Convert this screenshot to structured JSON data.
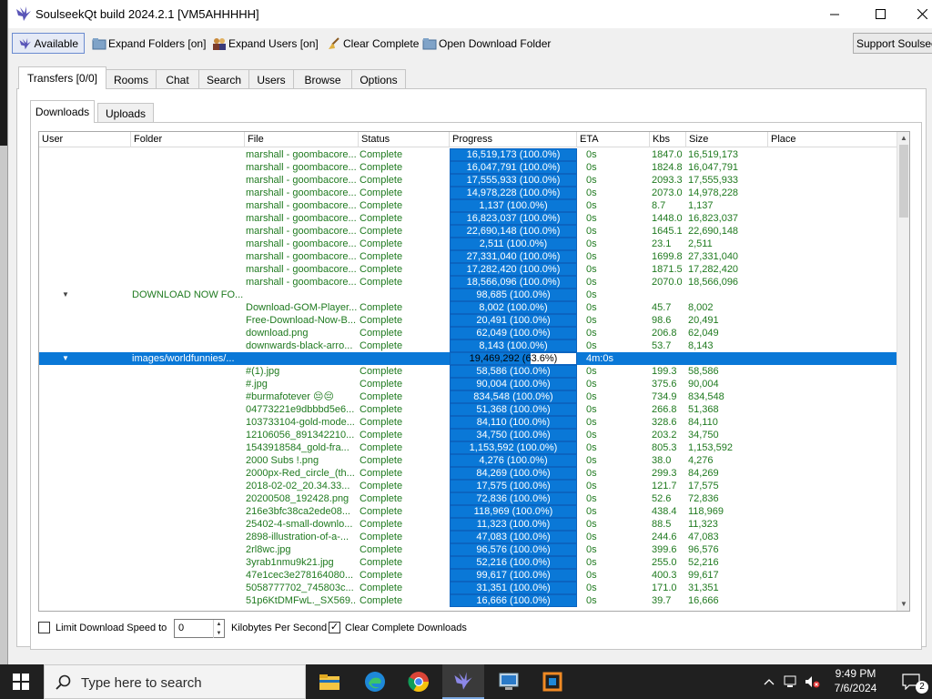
{
  "window": {
    "title": "SoulseekQt build 2024.2.1 [VM5AHHHHH]"
  },
  "toolbar": {
    "available": "Available",
    "expand_folders": "Expand Folders [on]",
    "expand_users": "Expand Users [on]",
    "clear_complete": "Clear Complete",
    "open_download_folder": "Open Download Folder",
    "support": "Support Soulseek"
  },
  "tabs": [
    "Transfers [0/0]",
    "Rooms",
    "Chat",
    "Search",
    "Users",
    "Browse",
    "Options"
  ],
  "subtabs": [
    "Downloads",
    "Uploads"
  ],
  "columns": [
    "User",
    "Folder",
    "File",
    "Status",
    "Progress",
    "ETA",
    "Kbs",
    "Size",
    "Place"
  ],
  "rows": [
    {
      "folder": "",
      "file": "marshall - goombacore...",
      "status": "Complete",
      "progress": "16,519,173 (100.0%)",
      "pct": 100,
      "eta": "0s",
      "kbs": "1847.0",
      "size": "16,519,173"
    },
    {
      "folder": "",
      "file": "marshall - goombacore...",
      "status": "Complete",
      "progress": "16,047,791 (100.0%)",
      "pct": 100,
      "eta": "0s",
      "kbs": "1824.8",
      "size": "16,047,791"
    },
    {
      "folder": "",
      "file": "marshall - goombacore...",
      "status": "Complete",
      "progress": "17,555,933 (100.0%)",
      "pct": 100,
      "eta": "0s",
      "kbs": "2093.3",
      "size": "17,555,933"
    },
    {
      "folder": "",
      "file": "marshall - goombacore...",
      "status": "Complete",
      "progress": "14,978,228 (100.0%)",
      "pct": 100,
      "eta": "0s",
      "kbs": "2073.0",
      "size": "14,978,228"
    },
    {
      "folder": "",
      "file": "marshall - goombacore...",
      "status": "Complete",
      "progress": "1,137 (100.0%)",
      "pct": 100,
      "eta": "0s",
      "kbs": "8.7",
      "size": "1,137"
    },
    {
      "folder": "",
      "file": "marshall - goombacore...",
      "status": "Complete",
      "progress": "16,823,037 (100.0%)",
      "pct": 100,
      "eta": "0s",
      "kbs": "1448.0",
      "size": "16,823,037"
    },
    {
      "folder": "",
      "file": "marshall - goombacore...",
      "status": "Complete",
      "progress": "22,690,148 (100.0%)",
      "pct": 100,
      "eta": "0s",
      "kbs": "1645.1",
      "size": "22,690,148"
    },
    {
      "folder": "",
      "file": "marshall - goombacore...",
      "status": "Complete",
      "progress": "2,511 (100.0%)",
      "pct": 100,
      "eta": "0s",
      "kbs": "23.1",
      "size": "2,511"
    },
    {
      "folder": "",
      "file": "marshall - goombacore...",
      "status": "Complete",
      "progress": "27,331,040 (100.0%)",
      "pct": 100,
      "eta": "0s",
      "kbs": "1699.8",
      "size": "27,331,040"
    },
    {
      "folder": "",
      "file": "marshall - goombacore...",
      "status": "Complete",
      "progress": "17,282,420 (100.0%)",
      "pct": 100,
      "eta": "0s",
      "kbs": "1871.5",
      "size": "17,282,420"
    },
    {
      "folder": "",
      "file": "marshall - goombacore...",
      "status": "Complete",
      "progress": "18,566,096 (100.0%)",
      "pct": 100,
      "eta": "0s",
      "kbs": "2070.0",
      "size": "18,566,096"
    },
    {
      "folder": "DOWNLOAD NOW FO...",
      "file": "",
      "status": "",
      "progress": "98,685 (100.0%)",
      "pct": 100,
      "eta": "0s",
      "kbs": "",
      "size": "",
      "arrow": "▼"
    },
    {
      "folder": "",
      "file": "Download-GOM-Player...",
      "status": "Complete",
      "progress": "8,002 (100.0%)",
      "pct": 100,
      "eta": "0s",
      "kbs": "45.7",
      "size": "8,002"
    },
    {
      "folder": "",
      "file": "Free-Download-Now-B...",
      "status": "Complete",
      "progress": "20,491 (100.0%)",
      "pct": 100,
      "eta": "0s",
      "kbs": "98.6",
      "size": "20,491"
    },
    {
      "folder": "",
      "file": "download.png",
      "status": "Complete",
      "progress": "62,049 (100.0%)",
      "pct": 100,
      "eta": "0s",
      "kbs": "206.8",
      "size": "62,049"
    },
    {
      "folder": "",
      "file": "downwards-black-arro...",
      "status": "Complete",
      "progress": "8,143 (100.0%)",
      "pct": 100,
      "eta": "0s",
      "kbs": "53.7",
      "size": "8,143"
    },
    {
      "folder": "images/worldfunnies/...",
      "file": "",
      "status": "",
      "progress": "19,469,292 (63.6%)",
      "pct": 63.6,
      "eta": "4m:0s",
      "kbs": "",
      "size": "",
      "arrow": "▼",
      "selected": true
    },
    {
      "folder": "",
      "file": "#(1).jpg",
      "status": "Complete",
      "progress": "58,586 (100.0%)",
      "pct": 100,
      "eta": "0s",
      "kbs": "199.3",
      "size": "58,586"
    },
    {
      "folder": "",
      "file": "#.jpg",
      "status": "Complete",
      "progress": "90,004 (100.0%)",
      "pct": 100,
      "eta": "0s",
      "kbs": "375.6",
      "size": "90,004"
    },
    {
      "folder": "",
      "file": "#burmafotever 😔😔",
      "status": "Complete",
      "progress": "834,548 (100.0%)",
      "pct": 100,
      "eta": "0s",
      "kbs": "734.9",
      "size": "834,548"
    },
    {
      "folder": "",
      "file": "04773221e9dbbbd5e6...",
      "status": "Complete",
      "progress": "51,368 (100.0%)",
      "pct": 100,
      "eta": "0s",
      "kbs": "266.8",
      "size": "51,368"
    },
    {
      "folder": "",
      "file": "103733104-gold-mode...",
      "status": "Complete",
      "progress": "84,110 (100.0%)",
      "pct": 100,
      "eta": "0s",
      "kbs": "328.6",
      "size": "84,110"
    },
    {
      "folder": "",
      "file": "12106056_891342210...",
      "status": "Complete",
      "progress": "34,750 (100.0%)",
      "pct": 100,
      "eta": "0s",
      "kbs": "203.2",
      "size": "34,750"
    },
    {
      "folder": "",
      "file": "1543918584_gold-fra...",
      "status": "Complete",
      "progress": "1,153,592 (100.0%)",
      "pct": 100,
      "eta": "0s",
      "kbs": "805.3",
      "size": "1,153,592"
    },
    {
      "folder": "",
      "file": "2000 Subs !.png",
      "status": "Complete",
      "progress": "4,276 (100.0%)",
      "pct": 100,
      "eta": "0s",
      "kbs": "38.0",
      "size": "4,276"
    },
    {
      "folder": "",
      "file": "2000px-Red_circle_(th...",
      "status": "Complete",
      "progress": "84,269 (100.0%)",
      "pct": 100,
      "eta": "0s",
      "kbs": "299.3",
      "size": "84,269"
    },
    {
      "folder": "",
      "file": "2018-02-02_20.34.33...",
      "status": "Complete",
      "progress": "17,575 (100.0%)",
      "pct": 100,
      "eta": "0s",
      "kbs": "121.7",
      "size": "17,575"
    },
    {
      "folder": "",
      "file": "20200508_192428.png",
      "status": "Complete",
      "progress": "72,836 (100.0%)",
      "pct": 100,
      "eta": "0s",
      "kbs": "52.6",
      "size": "72,836"
    },
    {
      "folder": "",
      "file": "216e3bfc38ca2ede08...",
      "status": "Complete",
      "progress": "118,969 (100.0%)",
      "pct": 100,
      "eta": "0s",
      "kbs": "438.4",
      "size": "118,969"
    },
    {
      "folder": "",
      "file": "25402-4-small-downlo...",
      "status": "Complete",
      "progress": "11,323 (100.0%)",
      "pct": 100,
      "eta": "0s",
      "kbs": "88.5",
      "size": "11,323"
    },
    {
      "folder": "",
      "file": "2898-illustration-of-a-...",
      "status": "Complete",
      "progress": "47,083 (100.0%)",
      "pct": 100,
      "eta": "0s",
      "kbs": "244.6",
      "size": "47,083"
    },
    {
      "folder": "",
      "file": "2rl8wc.jpg",
      "status": "Complete",
      "progress": "96,576 (100.0%)",
      "pct": 100,
      "eta": "0s",
      "kbs": "399.6",
      "size": "96,576"
    },
    {
      "folder": "",
      "file": "3yrab1nmu9k21.jpg",
      "status": "Complete",
      "progress": "52,216 (100.0%)",
      "pct": 100,
      "eta": "0s",
      "kbs": "255.0",
      "size": "52,216"
    },
    {
      "folder": "",
      "file": "47e1cec3e278164080...",
      "status": "Complete",
      "progress": "99,617 (100.0%)",
      "pct": 100,
      "eta": "0s",
      "kbs": "400.3",
      "size": "99,617"
    },
    {
      "folder": "",
      "file": "5058777702_745803c...",
      "status": "Complete",
      "progress": "31,351 (100.0%)",
      "pct": 100,
      "eta": "0s",
      "kbs": "171.0",
      "size": "31,351"
    },
    {
      "folder": "",
      "file": "51p6KtDMFwL._SX569...",
      "status": "Complete",
      "progress": "16,666 (100.0%)",
      "pct": 100,
      "eta": "0s",
      "kbs": "39.7",
      "size": "16,666"
    }
  ],
  "bottom": {
    "limit_label": "Limit Download Speed to",
    "limit_value": "0",
    "limit_unit": "Kilobytes Per Second",
    "clear_label": "Clear Complete Downloads"
  },
  "taskbar": {
    "search_placeholder": "Type here to search",
    "time": "9:49 PM",
    "date": "7/6/2024",
    "notifications": "2"
  },
  "colors": {
    "accent": "#0a78d7",
    "complete_text": "#1f7a1f",
    "taskbar": "#202020"
  }
}
